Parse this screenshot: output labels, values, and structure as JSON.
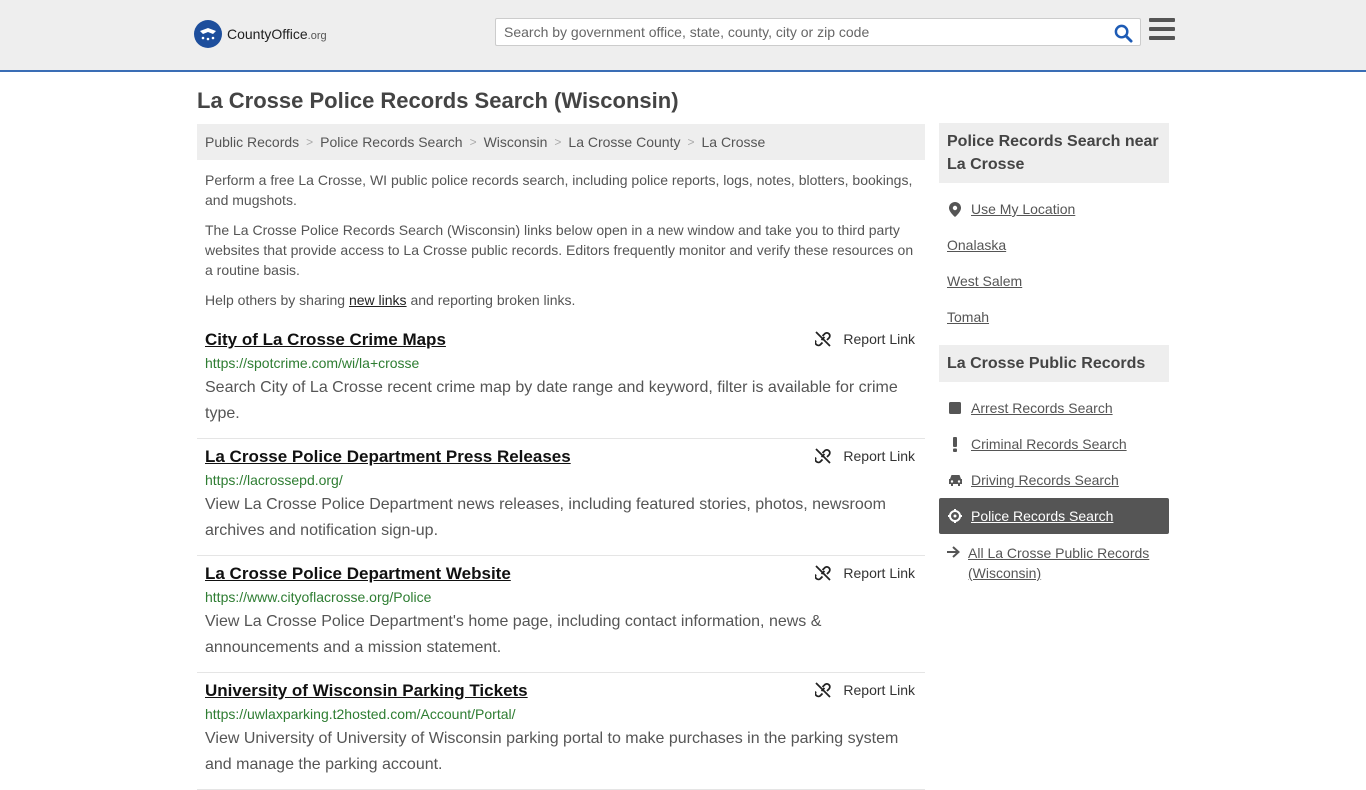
{
  "header": {
    "logo_name": "CountyOffice",
    "logo_suffix": ".org",
    "search_placeholder": "Search by government office, state, county, city or zip code"
  },
  "page_title": "La Crosse Police Records Search (Wisconsin)",
  "breadcrumb": [
    "Public Records",
    "Police Records Search",
    "Wisconsin",
    "La Crosse County",
    "La Crosse"
  ],
  "intro": {
    "p1": "Perform a free La Crosse, WI public police records search, including police reports, logs, notes, blotters, bookings, and mugshots.",
    "p2": "The La Crosse Police Records Search (Wisconsin) links below open in a new window and take you to third party websites that provide access to La Crosse public records. Editors frequently monitor and verify these resources on a routine basis.",
    "p3_before": "Help others by sharing ",
    "p3_link": "new links",
    "p3_after": " and reporting broken links."
  },
  "report_label": "Report Link",
  "results": [
    {
      "title": "City of La Crosse Crime Maps",
      "url": "https://spotcrime.com/wi/la+crosse",
      "desc": "Search City of La Crosse recent crime map by date range and keyword, filter is available for crime type."
    },
    {
      "title": "La Crosse Police Department Press Releases",
      "url": "https://lacrossepd.org/",
      "desc": "View La Crosse Police Department news releases, including featured stories, photos, newsroom archives and notification sign-up."
    },
    {
      "title": "La Crosse Police Department Website",
      "url": "https://www.cityoflacrosse.org/Police",
      "desc": "View La Crosse Police Department's home page, including contact information, news & announcements and a mission statement."
    },
    {
      "title": "University of Wisconsin Parking Tickets",
      "url": "https://uwlaxparking.t2hosted.com/Account/Portal/",
      "desc": "View University of University of Wisconsin parking portal to make purchases in the parking system and manage the parking account."
    }
  ],
  "sidebar": {
    "near_heading": "Police Records Search near La Crosse",
    "near_items": [
      "Use My Location",
      "Onalaska",
      "West Salem",
      "Tomah"
    ],
    "records_heading": "La Crosse Public Records",
    "records_items": [
      {
        "label": "Arrest Records Search",
        "icon": "square-icon"
      },
      {
        "label": "Criminal Records Search",
        "icon": "exclamation-icon"
      },
      {
        "label": "Driving Records Search",
        "icon": "car-icon"
      },
      {
        "label": "Police Records Search",
        "icon": "crosshair-icon"
      },
      {
        "label": "All La Crosse Public Records (Wisconsin)",
        "icon": "arrow-right-icon"
      }
    ]
  },
  "colors": {
    "accent": "#3a6db5",
    "url_green": "#2e7d32",
    "active_bg": "#555555"
  }
}
